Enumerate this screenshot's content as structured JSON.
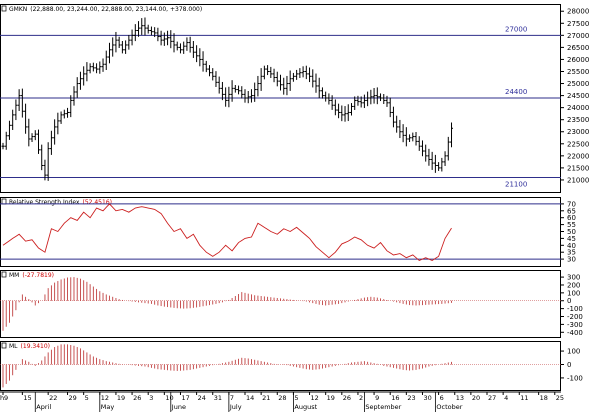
{
  "panels": {
    "price": {
      "title": "GMKN",
      "quote": "(22,888.00, 23,244.00, 22,888.00, 23,144.00, +378.000)",
      "levels": [
        {
          "value": 27000,
          "label": "27000"
        },
        {
          "value": 24400,
          "label": "24400"
        },
        {
          "value": 21100,
          "label": "21100"
        }
      ]
    },
    "rsi": {
      "title": "Relative Strength Index",
      "value_label": "(52.4516)",
      "levels": [
        30,
        70
      ]
    },
    "mm": {
      "title": "MM",
      "value_label": "(-27.7819)"
    },
    "ml": {
      "title": "ML",
      "value_label": "(19.3410)"
    }
  },
  "chart_data": [
    {
      "type": "ohlc",
      "title": "GMKN",
      "ylim": [
        20500,
        28300
      ],
      "yticks": [
        21000,
        21500,
        22000,
        22500,
        23000,
        23500,
        24000,
        24500,
        25000,
        25500,
        26000,
        26500,
        27000,
        27500,
        28000
      ],
      "close_keypoints": [
        [
          0,
          22400
        ],
        [
          3,
          23700
        ],
        [
          5,
          24500
        ],
        [
          7,
          23200
        ],
        [
          8,
          22700
        ],
        [
          10,
          22900
        ],
        [
          12,
          21600
        ],
        [
          13,
          21200
        ],
        [
          14,
          22300
        ],
        [
          16,
          23200
        ],
        [
          18,
          23700
        ],
        [
          20,
          23800
        ],
        [
          21,
          24300
        ],
        [
          23,
          25000
        ],
        [
          25,
          25400
        ],
        [
          27,
          25700
        ],
        [
          29,
          25600
        ],
        [
          31,
          25800
        ],
        [
          33,
          26400
        ],
        [
          35,
          26800
        ],
        [
          37,
          26400
        ],
        [
          39,
          26800
        ],
        [
          41,
          27200
        ],
        [
          43,
          27400
        ],
        [
          45,
          27200
        ],
        [
          47,
          27100
        ],
        [
          49,
          26800
        ],
        [
          51,
          26900
        ],
        [
          53,
          26600
        ],
        [
          55,
          26400
        ],
        [
          57,
          26700
        ],
        [
          59,
          26300
        ],
        [
          61,
          26000
        ],
        [
          63,
          25600
        ],
        [
          65,
          25300
        ],
        [
          67,
          24800
        ],
        [
          69,
          24300
        ],
        [
          71,
          24800
        ],
        [
          73,
          24700
        ],
        [
          75,
          24400
        ],
        [
          77,
          24500
        ],
        [
          79,
          25000
        ],
        [
          81,
          25600
        ],
        [
          83,
          25400
        ],
        [
          85,
          25100
        ],
        [
          87,
          24800
        ],
        [
          89,
          25200
        ],
        [
          91,
          25400
        ],
        [
          93,
          25500
        ],
        [
          95,
          25300
        ],
        [
          97,
          24900
        ],
        [
          99,
          24500
        ],
        [
          101,
          24300
        ],
        [
          103,
          23900
        ],
        [
          105,
          23700
        ],
        [
          107,
          23800
        ],
        [
          109,
          24300
        ],
        [
          111,
          24200
        ],
        [
          113,
          24400
        ],
        [
          115,
          24500
        ],
        [
          117,
          24400
        ],
        [
          119,
          24200
        ],
        [
          121,
          23400
        ],
        [
          123,
          23000
        ],
        [
          125,
          22700
        ],
        [
          127,
          22800
        ],
        [
          129,
          22400
        ],
        [
          131,
          22000
        ],
        [
          133,
          21700
        ],
        [
          135,
          21500
        ],
        [
          137,
          22000
        ],
        [
          139,
          23144
        ]
      ]
    },
    {
      "type": "line",
      "title": "Relative Strength Index",
      "ylim": [
        25,
        75
      ],
      "yticks": [
        30,
        35,
        40,
        45,
        50,
        55,
        60,
        65,
        70
      ],
      "keypoints": [
        [
          0,
          40
        ],
        [
          3,
          45
        ],
        [
          5,
          48
        ],
        [
          7,
          43
        ],
        [
          9,
          44
        ],
        [
          11,
          38
        ],
        [
          13,
          35
        ],
        [
          15,
          52
        ],
        [
          17,
          50
        ],
        [
          19,
          56
        ],
        [
          21,
          60
        ],
        [
          23,
          58
        ],
        [
          25,
          64
        ],
        [
          27,
          60
        ],
        [
          29,
          67
        ],
        [
          31,
          65
        ],
        [
          33,
          70
        ],
        [
          35,
          65
        ],
        [
          37,
          66
        ],
        [
          39,
          64
        ],
        [
          41,
          67
        ],
        [
          43,
          68
        ],
        [
          45,
          67
        ],
        [
          47,
          66
        ],
        [
          49,
          63
        ],
        [
          51,
          56
        ],
        [
          53,
          50
        ],
        [
          55,
          52
        ],
        [
          57,
          45
        ],
        [
          59,
          48
        ],
        [
          61,
          40
        ],
        [
          63,
          35
        ],
        [
          65,
          32
        ],
        [
          67,
          35
        ],
        [
          69,
          40
        ],
        [
          71,
          36
        ],
        [
          73,
          42
        ],
        [
          75,
          45
        ],
        [
          77,
          46
        ],
        [
          79,
          56
        ],
        [
          81,
          53
        ],
        [
          83,
          50
        ],
        [
          85,
          48
        ],
        [
          87,
          52
        ],
        [
          89,
          50
        ],
        [
          91,
          53
        ],
        [
          93,
          49
        ],
        [
          95,
          45
        ],
        [
          97,
          39
        ],
        [
          99,
          35
        ],
        [
          101,
          31
        ],
        [
          103,
          35
        ],
        [
          105,
          41
        ],
        [
          107,
          43
        ],
        [
          109,
          46
        ],
        [
          111,
          44
        ],
        [
          113,
          40
        ],
        [
          115,
          38
        ],
        [
          117,
          42
        ],
        [
          119,
          36
        ],
        [
          121,
          33
        ],
        [
          123,
          34
        ],
        [
          125,
          31
        ],
        [
          127,
          33
        ],
        [
          129,
          29
        ],
        [
          131,
          31
        ],
        [
          133,
          29
        ],
        [
          135,
          32
        ],
        [
          137,
          45
        ],
        [
          139,
          52.4516
        ]
      ]
    },
    {
      "type": "histogram",
      "title": "MM",
      "ylim": [
        -460,
        390
      ],
      "yticks": [
        -400,
        -300,
        -200,
        -100,
        0,
        100,
        200,
        300
      ],
      "keypoints": [
        [
          0,
          -380
        ],
        [
          2,
          -280
        ],
        [
          4,
          -120
        ],
        [
          6,
          80
        ],
        [
          8,
          20
        ],
        [
          10,
          -60
        ],
        [
          12,
          0
        ],
        [
          14,
          160
        ],
        [
          16,
          230
        ],
        [
          18,
          270
        ],
        [
          20,
          295
        ],
        [
          22,
          300
        ],
        [
          24,
          280
        ],
        [
          26,
          240
        ],
        [
          28,
          180
        ],
        [
          30,
          120
        ],
        [
          32,
          80
        ],
        [
          34,
          50
        ],
        [
          36,
          20
        ],
        [
          38,
          0
        ],
        [
          40,
          -10
        ],
        [
          42,
          -20
        ],
        [
          44,
          -30
        ],
        [
          46,
          -40
        ],
        [
          48,
          -60
        ],
        [
          50,
          -75
        ],
        [
          52,
          -85
        ],
        [
          54,
          -95
        ],
        [
          56,
          -100
        ],
        [
          58,
          -95
        ],
        [
          60,
          -85
        ],
        [
          62,
          -70
        ],
        [
          64,
          -55
        ],
        [
          66,
          -40
        ],
        [
          68,
          -20
        ],
        [
          70,
          10
        ],
        [
          72,
          60
        ],
        [
          74,
          110
        ],
        [
          76,
          90
        ],
        [
          78,
          70
        ],
        [
          80,
          60
        ],
        [
          82,
          50
        ],
        [
          84,
          40
        ],
        [
          86,
          30
        ],
        [
          88,
          20
        ],
        [
          90,
          10
        ],
        [
          92,
          0
        ],
        [
          94,
          -10
        ],
        [
          96,
          -30
        ],
        [
          98,
          -50
        ],
        [
          100,
          -60
        ],
        [
          102,
          -50
        ],
        [
          104,
          -40
        ],
        [
          106,
          -20
        ],
        [
          108,
          0
        ],
        [
          110,
          20
        ],
        [
          112,
          40
        ],
        [
          114,
          50
        ],
        [
          116,
          40
        ],
        [
          118,
          20
        ],
        [
          120,
          0
        ],
        [
          122,
          -20
        ],
        [
          124,
          -40
        ],
        [
          126,
          -55
        ],
        [
          128,
          -60
        ],
        [
          130,
          -55
        ],
        [
          132,
          -50
        ],
        [
          134,
          -45
        ],
        [
          136,
          -40
        ],
        [
          139,
          -27.7819
        ]
      ]
    },
    {
      "type": "histogram",
      "title": "ML",
      "ylim": [
        -190,
        175
      ],
      "yticks": [
        -100,
        0,
        100
      ],
      "keypoints": [
        [
          0,
          -170
        ],
        [
          2,
          -120
        ],
        [
          4,
          -40
        ],
        [
          6,
          40
        ],
        [
          8,
          20
        ],
        [
          10,
          -10
        ],
        [
          12,
          30
        ],
        [
          14,
          90
        ],
        [
          16,
          130
        ],
        [
          18,
          150
        ],
        [
          20,
          150
        ],
        [
          22,
          140
        ],
        [
          24,
          120
        ],
        [
          26,
          90
        ],
        [
          28,
          60
        ],
        [
          30,
          40
        ],
        [
          32,
          25
        ],
        [
          34,
          15
        ],
        [
          36,
          5
        ],
        [
          38,
          0
        ],
        [
          40,
          -5
        ],
        [
          42,
          -10
        ],
        [
          44,
          -15
        ],
        [
          46,
          -25
        ],
        [
          48,
          -35
        ],
        [
          50,
          -40
        ],
        [
          52,
          -45
        ],
        [
          54,
          -48
        ],
        [
          56,
          -45
        ],
        [
          58,
          -40
        ],
        [
          60,
          -30
        ],
        [
          62,
          -20
        ],
        [
          64,
          -10
        ],
        [
          66,
          0
        ],
        [
          68,
          10
        ],
        [
          70,
          20
        ],
        [
          72,
          35
        ],
        [
          74,
          50
        ],
        [
          76,
          45
        ],
        [
          78,
          35
        ],
        [
          80,
          25
        ],
        [
          82,
          15
        ],
        [
          84,
          5
        ],
        [
          86,
          0
        ],
        [
          88,
          -5
        ],
        [
          90,
          -15
        ],
        [
          92,
          -25
        ],
        [
          94,
          -35
        ],
        [
          96,
          -40
        ],
        [
          98,
          -35
        ],
        [
          100,
          -25
        ],
        [
          102,
          -15
        ],
        [
          104,
          -5
        ],
        [
          106,
          5
        ],
        [
          108,
          15
        ],
        [
          110,
          20
        ],
        [
          112,
          25
        ],
        [
          114,
          15
        ],
        [
          116,
          5
        ],
        [
          118,
          -10
        ],
        [
          120,
          -20
        ],
        [
          122,
          -30
        ],
        [
          124,
          -40
        ],
        [
          126,
          -45
        ],
        [
          128,
          -40
        ],
        [
          130,
          -30
        ],
        [
          132,
          -15
        ],
        [
          134,
          -5
        ],
        [
          136,
          5
        ],
        [
          139,
          19.341
        ]
      ]
    }
  ],
  "x_axis": {
    "ticks": [
      {
        "bar": 0,
        "label": "9"
      },
      {
        "bar": 6,
        "label": "15"
      },
      {
        "bar": 14,
        "label": "22"
      },
      {
        "bar": 20,
        "label": "29"
      },
      {
        "bar": 25,
        "label": "5"
      },
      {
        "bar": 30,
        "label": "12"
      },
      {
        "bar": 35,
        "label": "19"
      },
      {
        "bar": 40,
        "label": "26"
      },
      {
        "bar": 45,
        "label": "3"
      },
      {
        "bar": 50,
        "label": "10"
      },
      {
        "bar": 55,
        "label": "17"
      },
      {
        "bar": 60,
        "label": "24"
      },
      {
        "bar": 65,
        "label": "31"
      },
      {
        "bar": 70,
        "label": "7"
      },
      {
        "bar": 75,
        "label": "14"
      },
      {
        "bar": 80,
        "label": "21"
      },
      {
        "bar": 85,
        "label": "28"
      },
      {
        "bar": 90,
        "label": "5"
      },
      {
        "bar": 95,
        "label": "12"
      },
      {
        "bar": 100,
        "label": "19"
      },
      {
        "bar": 105,
        "label": "26"
      },
      {
        "bar": 110,
        "label": "2"
      },
      {
        "bar": 115,
        "label": "9"
      },
      {
        "bar": 120,
        "label": "16"
      },
      {
        "bar": 125,
        "label": "23"
      },
      {
        "bar": 130,
        "label": "30"
      },
      {
        "bar": 135,
        "label": "6"
      },
      {
        "bar": 140,
        "label": "13"
      },
      {
        "bar": 145,
        "label": "20"
      },
      {
        "bar": 150,
        "label": "27"
      },
      {
        "bar": 155,
        "label": "4"
      },
      {
        "bar": 160,
        "label": "11"
      },
      {
        "bar": 166,
        "label": "18"
      },
      {
        "bar": 171,
        "label": "25"
      }
    ],
    "months": [
      {
        "bar": 10,
        "label": "April"
      },
      {
        "bar": 30,
        "label": "May"
      },
      {
        "bar": 52,
        "label": "June"
      },
      {
        "bar": 70,
        "label": "July"
      },
      {
        "bar": 90,
        "label": "August"
      },
      {
        "bar": 112,
        "label": "September"
      },
      {
        "bar": 134,
        "label": "October"
      }
    ],
    "first_label": "h",
    "bar_count": 140,
    "slot_count": 172
  },
  "colors": {
    "axis": "#000000",
    "level_line": "#2e2e8a",
    "level_label": "#2e2e9a",
    "bar": "#000000",
    "rsi_line": "#cc2020",
    "histogram": "#c04040",
    "grid": "#9aa0b8",
    "title_text": "#000000",
    "value_text": "#cc0000"
  }
}
